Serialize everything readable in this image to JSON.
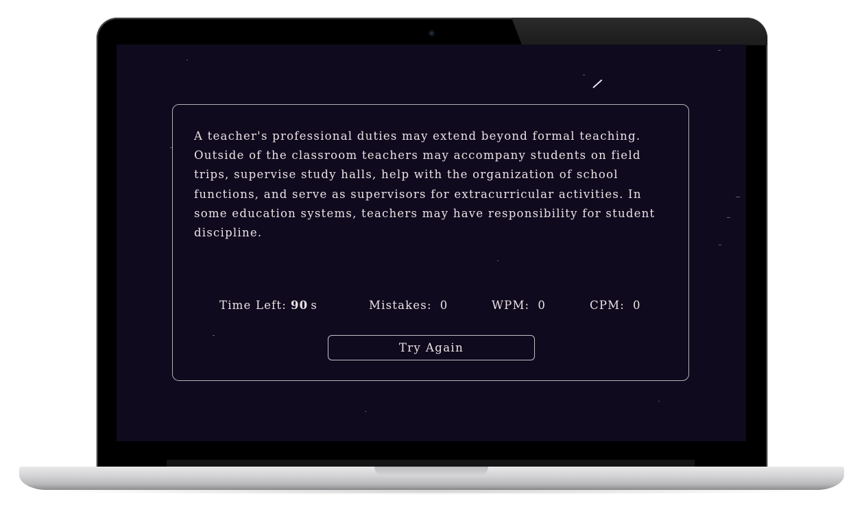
{
  "passage": {
    "text": "A teacher's professional duties may extend beyond formal teaching. Outside of the classroom teachers may accompany students on field trips, supervise study halls, help with the organization of school functions, and serve as supervisors for extracurricular activities. In some education systems, teachers may have responsibility for student discipline."
  },
  "stats": {
    "time_left_label": "Time Left:",
    "time_left_value": "90",
    "time_left_unit": "s",
    "mistakes_label": "Mistakes:",
    "mistakes_value": "0",
    "wpm_label": "WPM:",
    "wpm_value": "0",
    "cpm_label": "CPM:",
    "cpm_value": "0"
  },
  "actions": {
    "try_again_label": "Try Again"
  },
  "colors": {
    "screen_background": "#100a1e",
    "text": "#ece3e6",
    "card_border": "#b8b0b8"
  }
}
